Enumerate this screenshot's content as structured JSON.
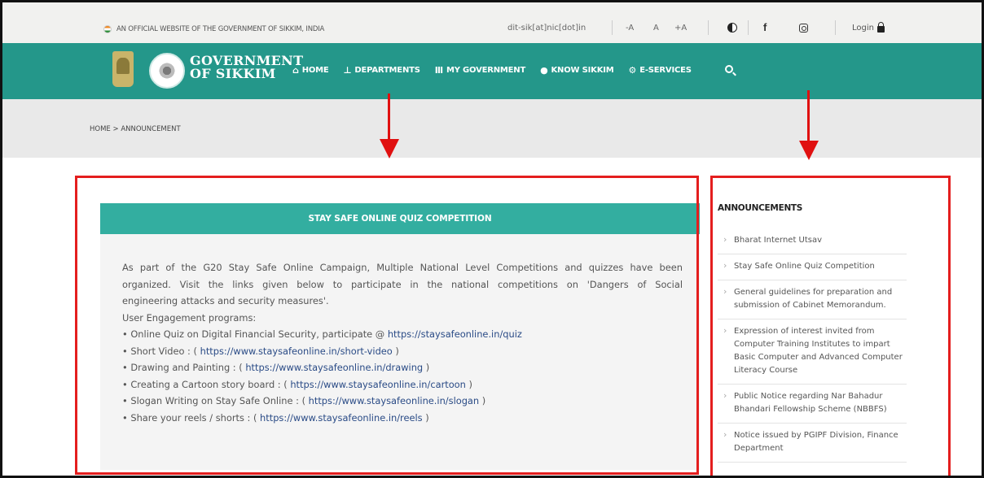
{
  "topbar": {
    "official_text": "AN OFFICIAL WEBSITE OF THE GOVERNMENT OF SIKKIM, INDIA",
    "email": "dit-sik[at]nic[dot]in",
    "font_decrease": "-A",
    "font_normal": "A",
    "font_increase": "+A",
    "facebook_glyph": "f",
    "login_label": "Login"
  },
  "brand": {
    "line1": "GOVERNMENT",
    "line2": "OF SIKKIM"
  },
  "nav": {
    "items": [
      {
        "label": "HOME",
        "icon": "home-icon"
      },
      {
        "label": "DEPARTMENTS",
        "icon": "sitemap-icon"
      },
      {
        "label": "MY GOVERNMENT",
        "icon": "government-building-icon"
      },
      {
        "label": "KNOW SIKKIM",
        "icon": "info-icon"
      },
      {
        "label": "E-SERVICES",
        "icon": "gear-icon"
      }
    ]
  },
  "breadcrumb": {
    "home": "HOME",
    "separator": ">",
    "current": "ANNOUNCEMENT"
  },
  "quiz": {
    "title": "STAY SAFE ONLINE QUIZ COMPETITION",
    "intro_lines": [
      "As part of the G20 Stay Safe Online Campaign, Multiple National Level Competitions and quizzes have been",
      "organized. Visit the links given below to participate in the national competitions on 'Dangers of Social"
    ],
    "intro_last": "engineering attacks and security measures'.",
    "programs_heading": "User Engagement programs:",
    "programs": [
      {
        "prefix": "• Online Quiz on Digital Financial Security, participate @ ",
        "link": "https://staysafeonline.in/quiz",
        "suffix": ""
      },
      {
        "prefix": "• Short Video : ( ",
        "link": "https://www.staysafeonline.in/short-video",
        "suffix": " )"
      },
      {
        "prefix": "• Drawing and Painting : ( ",
        "link": "https://www.staysafeonline.in/drawing",
        "suffix": " )"
      },
      {
        "prefix": "• Creating a Cartoon story board : ( ",
        "link": "https://www.staysafeonline.in/cartoon",
        "suffix": " )"
      },
      {
        "prefix": "• Slogan Writing on Stay Safe Online : ( ",
        "link": "https://www.staysafeonline.in/slogan",
        "suffix": " )"
      },
      {
        "prefix": "• Share your reels / shorts : ( ",
        "link": "https://www.staysafeonline.in/reels",
        "suffix": " )"
      }
    ]
  },
  "announcements": {
    "heading": "ANNOUNCEMENTS",
    "items": [
      "Bharat Internet Utsav",
      "Stay Safe Online Quiz Competition",
      "General guidelines for preparation and submission of Cabinet Memorandum.",
      "Expression of interest invited from Computer Training Institutes to impart Basic Computer and Advanced Computer Literacy Course",
      "Public Notice regarding Nar Bahadur Bhandari Fellowship Scheme (NBBFS)",
      "Notice issued by PGIPF Division, Finance Department"
    ]
  },
  "colors": {
    "nav_bg": "#24978a",
    "panel_header": "#33aea0",
    "highlight_red": "#e41e1e",
    "link_blue": "#2a4b86"
  }
}
